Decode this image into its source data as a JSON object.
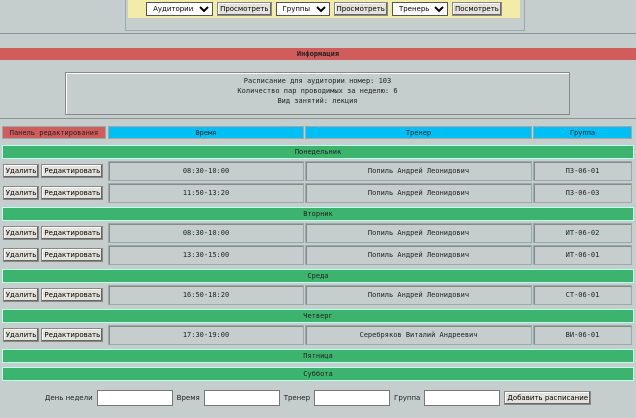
{
  "filters": [
    {
      "select": "Аудитории",
      "button": "Просмотреть"
    },
    {
      "select": "Группы",
      "button": "Просмотреть"
    },
    {
      "select": "Тренеры",
      "button": "Посмотреть"
    }
  ],
  "info_title": "Информация",
  "info_lines": [
    "Расписание для аудитории номер: 103",
    "Количество пар проводимых за неделю: 6",
    "Вид занятий: лекция"
  ],
  "headers": [
    "Панель редактирования",
    "Время",
    "Тренер",
    "Группа"
  ],
  "delete_label": "Удалить",
  "edit_label": "Редактировать",
  "days": [
    {
      "name": "Понедельник",
      "rows": [
        {
          "time": "08:30-10:00",
          "trainer": "Попиль Андрей Леонидович",
          "group": "ПЗ-06-01"
        },
        {
          "time": "11:50-13:20",
          "trainer": "Попиль Андрей Леонидович",
          "group": "ПЗ-06-03"
        }
      ]
    },
    {
      "name": "Вторник",
      "rows": [
        {
          "time": "08:30-10:00",
          "trainer": "Попиль Андрей Леонидович",
          "group": "ИТ-06-02"
        },
        {
          "time": "13:30-15:00",
          "trainer": "Попиль Андрей Леонидович",
          "group": "ИТ-06-01"
        }
      ]
    },
    {
      "name": "Среда",
      "rows": [
        {
          "time": "16:50-18:20",
          "trainer": "Попиль Андрей Леонидович",
          "group": "СТ-06-01"
        }
      ]
    },
    {
      "name": "Четверг",
      "rows": [
        {
          "time": "17:30-19:00",
          "trainer": "Серебряков Виталий Андреевич",
          "group": "ВИ-06-01"
        }
      ]
    },
    {
      "name": "Пятница",
      "rows": []
    },
    {
      "name": "Суббота",
      "rows": []
    }
  ],
  "form": {
    "day_label": "День недели",
    "time_label": "Время",
    "trainer_label": "Тренер",
    "group_label": "Группа",
    "submit": "Добавить расписание"
  }
}
